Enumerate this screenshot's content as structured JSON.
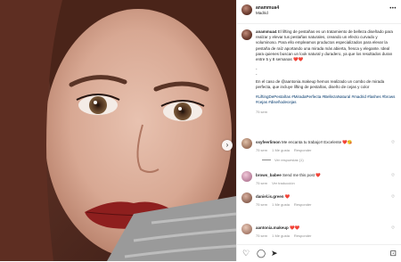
{
  "post": {
    "username": "anammua4",
    "location": "Madrid",
    "more_label": "•••",
    "next_label": "›"
  },
  "caption": {
    "username": "anammua4",
    "para1": "El lifting de pestañas es un tratamiento de belleza diseñado para realzar y elevar tus pestañas naturales, creando un efecto curvado y voluminoso. Para ello empleamos productos especializados para elevar la pestaña de raíz aportando una mirada más abierta, fresca y elegante. Ideal para quienes buscan un look natural y duradero, ya que los resultados duran entre 5 y 8 semanas ❤️❤️",
    "dash1": "-",
    "dash2": "-",
    "para2": "En el caso de @aantonia.makeup hemos realizado un combo de mirada perfecta, que incluye lifting de pestañas, diseño de cejas y color",
    "tags": "#LiftingDePestañas #MiradaPerfecta #BellezaNatural #madrid #lashes #brows #cejas #diseñodecejas",
    "time": "75 sem"
  },
  "comments": [
    {
      "username": "ssyfeerlimon",
      "text": "Me encanta tu trabajo!! Excelente ❤️😘",
      "time": "75 sem",
      "likes": "1 Me gusta",
      "reply": "Responder",
      "replies": "Ver respuestas (1)"
    },
    {
      "username": "brows_babee",
      "text": "Send me this post ❤️",
      "time": "75 sem",
      "reply": "Ver traducción",
      "likes": ""
    },
    {
      "username": "daniel.is.green",
      "text": "❤️",
      "time": "75 sem",
      "likes": "1 Me gusta",
      "reply": "Responder"
    },
    {
      "username": "aantonia.makeup",
      "text": "❤️❤️",
      "time": "75 sem",
      "likes": "1 Me gusta",
      "reply": "Responder"
    }
  ],
  "actions": {
    "like_icon": "♡",
    "comment_icon": "◯",
    "share_icon": "➤",
    "save_icon": "⊡"
  }
}
